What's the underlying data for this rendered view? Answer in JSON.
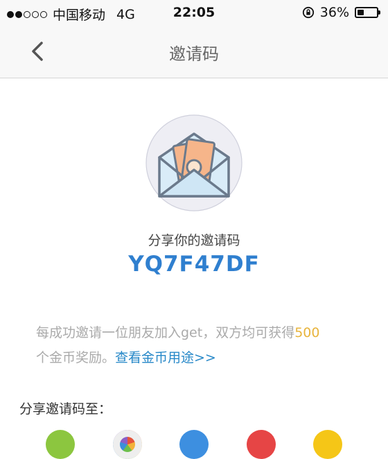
{
  "status_bar": {
    "carrier": "中国移动",
    "network": "4G",
    "time": "22:05",
    "battery_percent": "36%",
    "battery_level": 0.36
  },
  "nav": {
    "title": "邀请码",
    "back_icon": "chevron-left-icon"
  },
  "hero": {
    "icon": "envelope-money-icon",
    "share_label": "分享你的邀请码",
    "code": "YQ7F47DF"
  },
  "description": {
    "text_before": "每成功邀请一位朋友加入get，双方均可获得",
    "coins": "500",
    "text_after": "个金币奖励。",
    "link": "查看金币用途>>"
  },
  "share": {
    "label": "分享邀请码至：",
    "targets": [
      {
        "icon": "wechat-icon",
        "color": "#8cc63f"
      },
      {
        "icon": "moments-icon",
        "color": "#e8e8ee"
      },
      {
        "icon": "qq-icon",
        "color": "#3d8fe0"
      },
      {
        "icon": "weibo-icon",
        "color": "#e64545"
      },
      {
        "icon": "qzone-icon",
        "color": "#f5c617"
      }
    ]
  },
  "colors": {
    "accent_blue": "#2f7fcf",
    "link_blue": "#2788c8",
    "coins_gold": "#e8b43c"
  }
}
